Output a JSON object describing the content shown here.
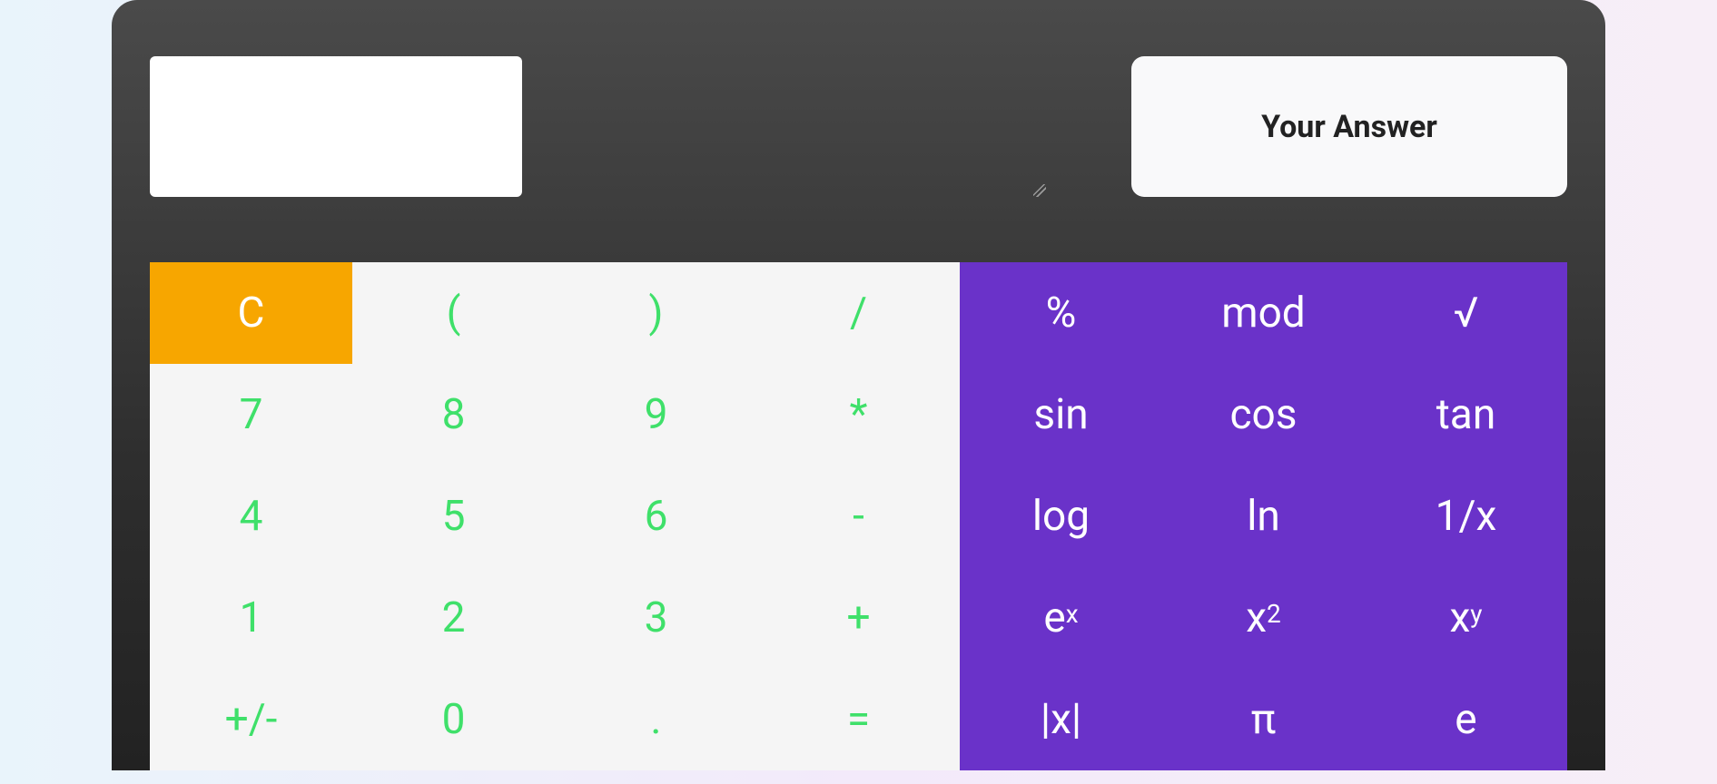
{
  "display": {
    "value": ""
  },
  "answer": {
    "label": "Your Answer"
  },
  "keys": {
    "clear": "C",
    "lparen": "(",
    "rparen": ")",
    "divide": "/",
    "percent": "%",
    "mod": "mod",
    "sqrt": "√",
    "d7": "7",
    "d8": "8",
    "d9": "9",
    "multiply": "*",
    "sin": "sin",
    "cos": "cos",
    "tan": "tan",
    "d4": "4",
    "d5": "5",
    "d6": "6",
    "minus": "-",
    "log": "log",
    "ln": "ln",
    "reciprocal": "1/x",
    "d1": "1",
    "d2": "2",
    "d3": "3",
    "plus": "+",
    "exp_base": "e",
    "exp_sup": "x",
    "sq_base": "x",
    "sq_sup": "2",
    "pow_base": "x",
    "pow_sup": "y",
    "plusminus": "+/-",
    "d0": "0",
    "dot": ".",
    "equals": "=",
    "abs": "|x|",
    "pi": "π",
    "e": "e"
  }
}
